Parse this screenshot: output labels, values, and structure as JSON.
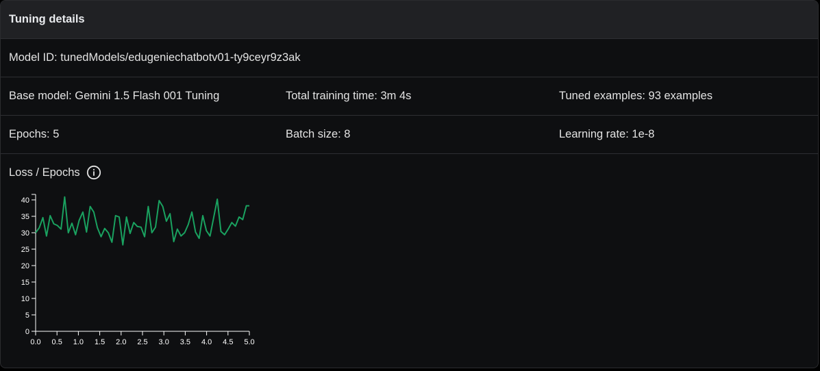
{
  "header": {
    "title": "Tuning details"
  },
  "model_id": {
    "label": "Model ID: tunedModels/edugeniechatbotv01-ty9ceyr9z3ak"
  },
  "details": {
    "base_model": "Base model: Gemini 1.5 Flash 001 Tuning",
    "training_time": "Total training time: 3m 4s",
    "tuned_examples": "Tuned examples: 93 examples",
    "epochs": "Epochs: 5",
    "batch_size": "Batch size: 8",
    "learning_rate": "Learning rate: 1e-8"
  },
  "chart_section": {
    "title": "Loss / Epochs",
    "info_icon": "info-icon"
  },
  "colors": {
    "line": "#1aa260",
    "background": "#0e0f11",
    "header_bg": "#202124",
    "axis": "#ffffff"
  },
  "chart_data": {
    "type": "line",
    "title": "",
    "xlabel": "",
    "ylabel": "",
    "xlim": [
      0,
      5
    ],
    "ylim": [
      0,
      40
    ],
    "xticks": [
      "0.0",
      "0.5",
      "1.0",
      "1.5",
      "2.0",
      "2.5",
      "3.0",
      "3.5",
      "4.0",
      "4.5",
      "5.0"
    ],
    "yticks": [
      "0",
      "5",
      "10",
      "15",
      "20",
      "25",
      "30",
      "35",
      "40"
    ],
    "grid": false,
    "series": [
      {
        "x": [
          0.0,
          0.085,
          0.17,
          0.255,
          0.34,
          0.425,
          0.51,
          0.595,
          0.68,
          0.765,
          0.85,
          0.935,
          1.02,
          1.105,
          1.19,
          1.275,
          1.36,
          1.445,
          1.53,
          1.615,
          1.7,
          1.785,
          1.87,
          1.955,
          2.04,
          2.125,
          2.21,
          2.295,
          2.38,
          2.465,
          2.55,
          2.635,
          2.72,
          2.805,
          2.89,
          2.975,
          3.06,
          3.145,
          3.23,
          3.315,
          3.4,
          3.485,
          3.57,
          3.655,
          3.74,
          3.825,
          3.91,
          3.995,
          4.08,
          4.165,
          4.25,
          4.335,
          4.42,
          4.505,
          4.59,
          4.675,
          4.76,
          4.845,
          4.93,
          5.0
        ],
        "y": [
          30.0,
          31.5,
          34.6,
          29.0,
          35.2,
          32.7,
          32.2,
          31.1,
          40.9,
          30.0,
          32.9,
          29.4,
          33.8,
          36.3,
          30.2,
          38.0,
          36.3,
          31.5,
          28.8,
          31.3,
          30.0,
          27.1,
          35.2,
          34.8,
          26.3,
          34.8,
          29.8,
          33.1,
          31.9,
          31.7,
          28.8,
          38.0,
          30.0,
          31.7,
          39.8,
          38.0,
          33.5,
          35.8,
          27.3,
          31.1,
          29.0,
          30.0,
          32.5,
          36.3,
          30.2,
          28.3,
          35.2,
          30.6,
          29.0,
          34.6,
          40.2,
          30.4,
          29.4,
          31.1,
          33.1,
          32.0,
          34.8,
          34.0,
          38.2,
          38.2
        ]
      }
    ]
  }
}
